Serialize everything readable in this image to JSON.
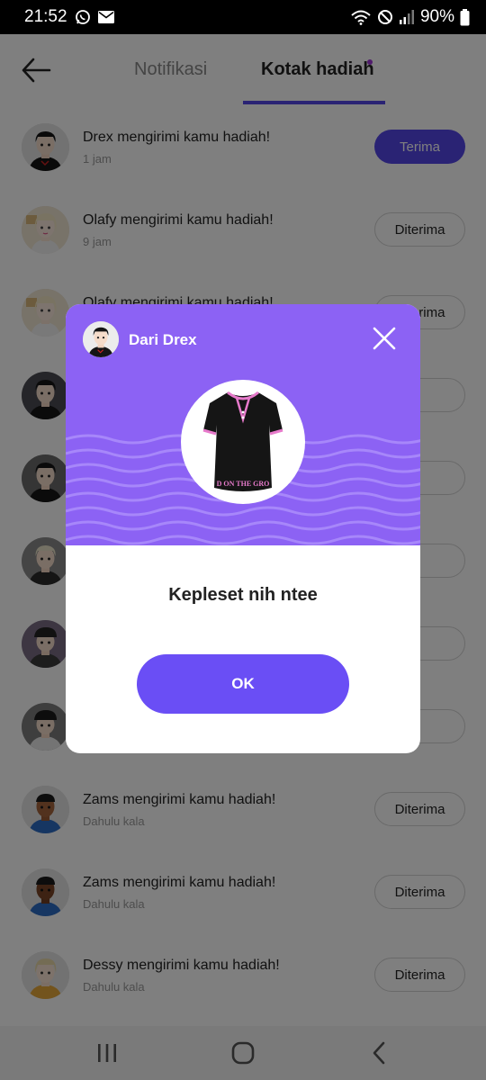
{
  "status_bar": {
    "time": "21:52",
    "battery": "90%",
    "left_icons": [
      "whatsapp-icon",
      "mail-icon"
    ],
    "right_icons": [
      "wifi-icon",
      "do-not-disturb-icon",
      "signal-icon",
      "battery-icon"
    ]
  },
  "header": {
    "back_icon": "back-arrow-icon",
    "tabs": [
      {
        "label": "Notifikasi",
        "active": false
      },
      {
        "label": "Kotak hadiah",
        "active": true,
        "has_dot": true
      }
    ]
  },
  "gifts": [
    {
      "sender": "Drex",
      "text": "Drex mengirimi kamu hadiah!",
      "time": "1 jam",
      "button": "Terima",
      "state": "pending"
    },
    {
      "sender": "Olafy",
      "text": "Olafy mengirimi kamu hadiah!",
      "time": "9 jam",
      "button": "Diterima",
      "state": "accepted"
    },
    {
      "sender": "Olafy",
      "text": "Olafy mengirimi kamu hadiah!",
      "time": "",
      "button": "Diterima",
      "state": "accepted"
    },
    {
      "sender": "",
      "text": "",
      "time": "",
      "button": "",
      "state": "accepted"
    },
    {
      "sender": "",
      "text": "",
      "time": "",
      "button": "",
      "state": "accepted"
    },
    {
      "sender": "",
      "text": "",
      "time": "",
      "button": "",
      "state": "accepted"
    },
    {
      "sender": "",
      "text": "",
      "time": "",
      "button": "",
      "state": "accepted"
    },
    {
      "sender": "",
      "text": "",
      "time": "",
      "button": "",
      "state": "accepted"
    },
    {
      "sender": "Zams",
      "text": "Zams mengirimi kamu hadiah!",
      "time": "Dahulu kala",
      "button": "Diterima",
      "state": "accepted"
    },
    {
      "sender": "Zams",
      "text": "Zams mengirimi kamu hadiah!",
      "time": "Dahulu kala",
      "button": "Diterima",
      "state": "accepted"
    },
    {
      "sender": "Dessy",
      "text": "Dessy mengirimi kamu hadiah!",
      "time": "Dahulu kala",
      "button": "Diterima",
      "state": "accepted"
    }
  ],
  "modal": {
    "title": "Dari Drex",
    "close_icon": "close-icon",
    "gift_item": "black-dress",
    "gift_print": "D ON THE GRO",
    "message": "Kepleset nih ntee",
    "ok_label": "OK"
  },
  "nav_bar": {
    "icons": [
      "recent-apps-icon",
      "home-icon",
      "back-icon"
    ]
  },
  "colors": {
    "accent": "#5446e8",
    "modal_header": "#8c62f4",
    "ok_button": "#6a4ef5",
    "tab_dot": "#a037d8"
  }
}
